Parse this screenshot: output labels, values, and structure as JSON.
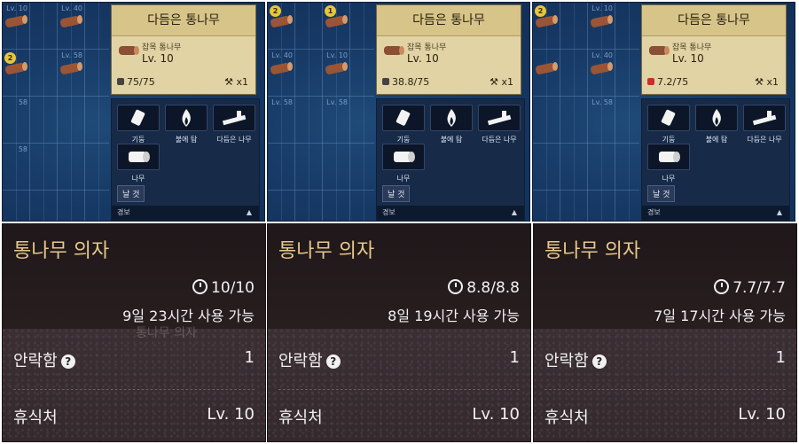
{
  "top_panels": [
    {
      "detail": {
        "title": "다듬은 통나무",
        "name": "잡목 통나무",
        "level": "Lv. 10",
        "durability": "75/75",
        "count": "x1",
        "durability_color": "dark"
      },
      "actions": [
        {
          "label": "기둥"
        },
        {
          "label": "불에 탐"
        },
        {
          "label": "다듬은 나무"
        },
        {
          "label": "나무"
        }
      ],
      "craft_label": "날 것",
      "info_label": "경보",
      "grid_labels": [
        "Lv. 10",
        "Lv. 40",
        "Lv. 58",
        "58",
        "58"
      ],
      "badges": [
        "2"
      ]
    },
    {
      "detail": {
        "title": "다듬은 통나무",
        "name": "잡목 통나무",
        "level": "Lv. 10",
        "durability": "38.8/75",
        "count": "x1",
        "durability_color": "dark"
      },
      "actions": [
        {
          "label": "기둥"
        },
        {
          "label": "불에 탐"
        },
        {
          "label": "다듬은 나무"
        },
        {
          "label": "나무"
        }
      ],
      "craft_label": "날 것",
      "info_label": "경보",
      "grid_labels": [
        "Lv. 10",
        "Lv. 40",
        "Lv. 10",
        "Lv. 58",
        "Lv. 58"
      ],
      "badges": [
        "2",
        "1"
      ]
    },
    {
      "detail": {
        "title": "다듬은 통나무",
        "name": "잡목 통나무",
        "level": "Lv. 10",
        "durability": "7.2/75",
        "count": "x1",
        "durability_color": "red"
      },
      "actions": [
        {
          "label": "기둥"
        },
        {
          "label": "불에 탐"
        },
        {
          "label": "다듬은 나무"
        },
        {
          "label": "나무"
        }
      ],
      "craft_label": "날 것",
      "info_label": "경보",
      "grid_labels": [
        "Lv. 10",
        "Lv. 40",
        "Lv. 58"
      ],
      "badges": [
        "2"
      ]
    }
  ],
  "bottom_panels": [
    {
      "title": "통나무 의자",
      "durability": "10/10",
      "available": "9일 23시간 사용 가능",
      "comfort_label": "안락함",
      "comfort_value": "1",
      "shelter_label": "휴식처",
      "shelter_value": "Lv. 10",
      "ghost_text": "통나무 의자"
    },
    {
      "title": "통나무 의자",
      "durability": "8.8/8.8",
      "available": "8일 19시간 사용 가능",
      "comfort_label": "안락함",
      "comfort_value": "1",
      "shelter_label": "휴식처",
      "shelter_value": "Lv. 10",
      "ghost_text": ""
    },
    {
      "title": "통나무 의자",
      "durability": "7.7/7.7",
      "available": "7일 17시간 사용 가능",
      "comfort_label": "안락함",
      "comfort_value": "1",
      "shelter_label": "휴식처",
      "shelter_value": "Lv. 10",
      "ghost_text": ""
    }
  ],
  "icons": {
    "log": "log-icon",
    "pillar": "pillar-icon",
    "fire": "fire-icon",
    "plank": "plank-icon",
    "wood": "wood-icon",
    "clock": "clock-icon",
    "help": "help-icon"
  },
  "colors": {
    "panel_blue": "#173a66",
    "detail_tan": "#e2d3a4",
    "title_gold": "#e6c98a",
    "badge_yellow": "#e7c63c"
  }
}
